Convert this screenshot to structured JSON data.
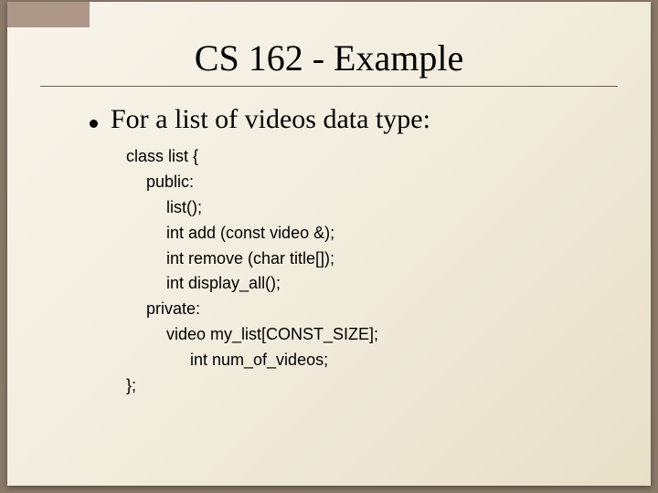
{
  "title": "CS 162 - Example",
  "bullet": "For a list of videos data type:",
  "code": {
    "l0": "class list {",
    "l1": "public:",
    "l2": "list();",
    "l3": "int add (const video &);",
    "l4": "int remove (char title[]);",
    "l5": "int display_all();",
    "l6": "private:",
    "l7": "video my_list[CONST_SIZE];",
    "l8": "int num_of_videos;",
    "l9": "};"
  }
}
